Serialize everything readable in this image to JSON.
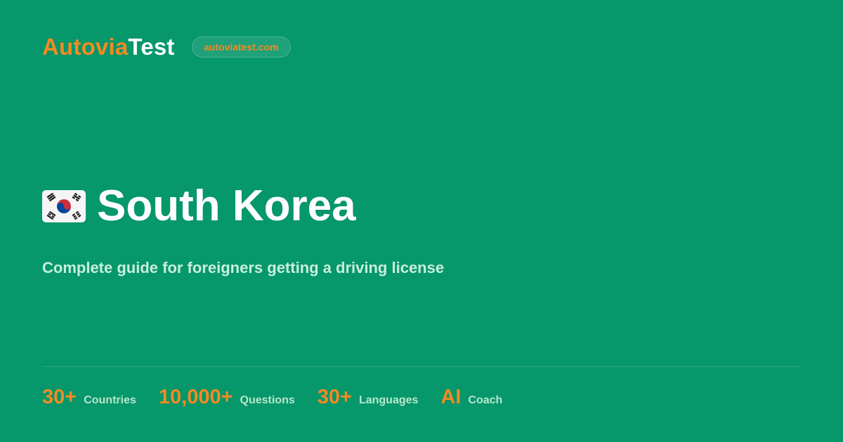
{
  "brand": {
    "part1": "Autovia",
    "part2": "Test",
    "domain": "autoviatest.com"
  },
  "hero": {
    "flag_icon": "south-korea-flag-icon",
    "title": "South Korea",
    "subtitle": "Complete guide for foreigners getting a driving license"
  },
  "stats": [
    {
      "value": "30+",
      "label": "Countries"
    },
    {
      "value": "10,000+",
      "label": "Questions"
    },
    {
      "value": "30+",
      "label": "Languages"
    },
    {
      "value": "AI",
      "label": "Coach"
    }
  ],
  "colors": {
    "background": "#06976a",
    "accent": "#f28a23",
    "text_primary": "#ffffff",
    "text_muted": "#c8efdc"
  }
}
